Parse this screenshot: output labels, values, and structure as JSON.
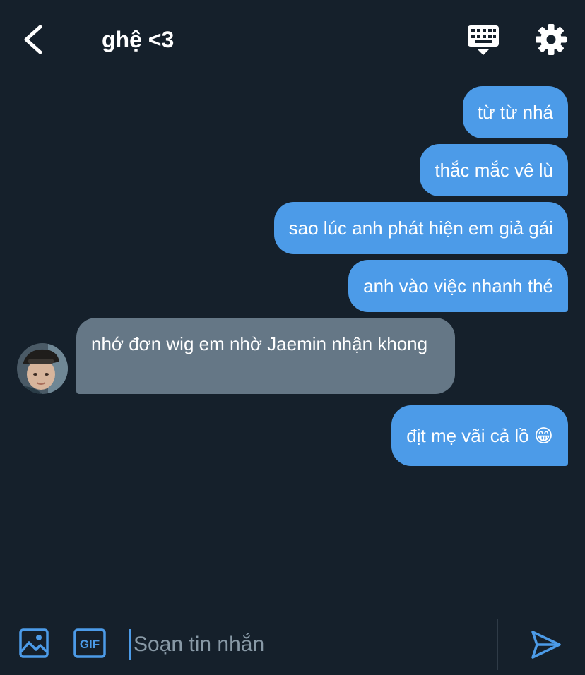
{
  "header": {
    "back_icon": "chevron-left-icon",
    "title": "ghệ <3",
    "keyboard_icon": "keyboard-icon",
    "settings_icon": "gear-icon"
  },
  "messages": [
    {
      "direction": "outgoing",
      "text": "từ từ nhá"
    },
    {
      "direction": "outgoing",
      "text": "thắc mắc vê lù"
    },
    {
      "direction": "outgoing",
      "text": "sao lúc anh phát hiện em giả gái"
    },
    {
      "direction": "outgoing",
      "text": "anh vào việc nhanh thé"
    },
    {
      "direction": "incoming",
      "text": "nhớ đơn wig em nhờ Jaemin nhận khong"
    },
    {
      "direction": "outgoing",
      "text": "địt mẹ vãi cả lồ 😁"
    }
  ],
  "composer": {
    "placeholder": "Soạn tin nhắn",
    "value": "",
    "image_icon": "image-icon",
    "gif_icon": "gif-icon",
    "send_icon": "send-icon"
  },
  "colors": {
    "background": "#15202b",
    "outgoing_bubble": "#4c9be8",
    "incoming_bubble": "#657786",
    "accent": "#4c9be8",
    "placeholder": "#8899a6"
  }
}
